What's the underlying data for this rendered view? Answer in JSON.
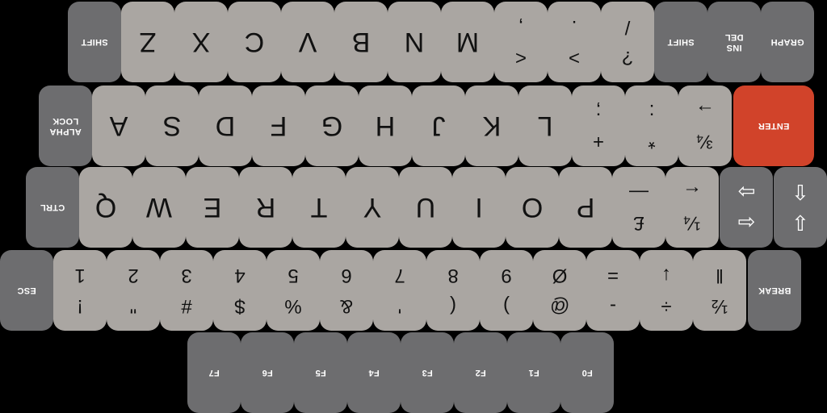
{
  "colors": {
    "light_key": "#aaa6a2",
    "dark_key": "#6d6d6f",
    "enter_key": "#d1432a",
    "background": "#000000"
  },
  "keyboard": {
    "row_function": [
      {
        "id": "f0",
        "label": "F0"
      },
      {
        "id": "f1",
        "label": "F1"
      },
      {
        "id": "f2",
        "label": "F2"
      },
      {
        "id": "f3",
        "label": "F3"
      },
      {
        "id": "f4",
        "label": "F4"
      },
      {
        "id": "f5",
        "label": "F5"
      },
      {
        "id": "f6",
        "label": "F6"
      },
      {
        "id": "f7",
        "label": "F7"
      }
    ],
    "row_number": [
      {
        "id": "esc",
        "label": "ESC"
      },
      {
        "id": "1",
        "top": "!",
        "bottom": "1"
      },
      {
        "id": "2",
        "top": "\"",
        "bottom": "2"
      },
      {
        "id": "3",
        "top": "#",
        "bottom": "3"
      },
      {
        "id": "4",
        "top": "$",
        "bottom": "4"
      },
      {
        "id": "5",
        "top": "%",
        "bottom": "5"
      },
      {
        "id": "6",
        "top": "&",
        "bottom": "6"
      },
      {
        "id": "7",
        "top": "'",
        "bottom": "7"
      },
      {
        "id": "8",
        "top": "(",
        "bottom": "8"
      },
      {
        "id": "9",
        "top": ")",
        "bottom": "9"
      },
      {
        "id": "0",
        "top": "@",
        "bottom": "Ø"
      },
      {
        "id": "minus",
        "top": "-",
        "bottom": "="
      },
      {
        "id": "divide",
        "top": "÷",
        "bottom": "↓"
      },
      {
        "id": "half",
        "top": "½",
        "bottom": "‖"
      },
      {
        "id": "break",
        "label": "BREAK"
      }
    ],
    "row_top": [
      {
        "id": "ctrl",
        "label": "CTRL"
      },
      {
        "id": "q",
        "letter": "Q"
      },
      {
        "id": "w",
        "letter": "W"
      },
      {
        "id": "e",
        "letter": "E"
      },
      {
        "id": "r",
        "letter": "R"
      },
      {
        "id": "t",
        "letter": "T"
      },
      {
        "id": "y",
        "letter": "Y"
      },
      {
        "id": "u",
        "letter": "U"
      },
      {
        "id": "i",
        "letter": "I"
      },
      {
        "id": "o",
        "letter": "O"
      },
      {
        "id": "p",
        "letter": "P"
      },
      {
        "id": "pound",
        "top": "£",
        "bottom": "—"
      },
      {
        "id": "quarter",
        "top": "¼",
        "bottom": "←"
      },
      {
        "id": "arrows-lr",
        "top": "⇦",
        "bottom": "⇨"
      },
      {
        "id": "arrows-ud",
        "top": "⇩",
        "bottom": "⇧"
      }
    ],
    "row_home": [
      {
        "id": "alpha-lock",
        "label": "ALPHA LOCK"
      },
      {
        "id": "a",
        "letter": "A"
      },
      {
        "id": "s",
        "letter": "S"
      },
      {
        "id": "d",
        "letter": "D"
      },
      {
        "id": "f",
        "letter": "F"
      },
      {
        "id": "g",
        "letter": "G"
      },
      {
        "id": "h",
        "letter": "H"
      },
      {
        "id": "j",
        "letter": "J"
      },
      {
        "id": "k",
        "letter": "K"
      },
      {
        "id": "l",
        "letter": "L"
      },
      {
        "id": "semicolon",
        "top": "+",
        "bottom": ";"
      },
      {
        "id": "colon",
        "top": "*",
        "bottom": ":"
      },
      {
        "id": "threequarter",
        "top": "¾",
        "bottom": "→"
      },
      {
        "id": "enter",
        "label": "ENTER"
      }
    ],
    "row_bottom": [
      {
        "id": "shift-left",
        "label": "SHIFT"
      },
      {
        "id": "z",
        "letter": "Z"
      },
      {
        "id": "x",
        "letter": "X"
      },
      {
        "id": "c",
        "letter": "C"
      },
      {
        "id": "v",
        "letter": "V"
      },
      {
        "id": "b",
        "letter": "B"
      },
      {
        "id": "n",
        "letter": "N"
      },
      {
        "id": "m",
        "letter": "M"
      },
      {
        "id": "comma",
        "top": "<",
        "bottom": ","
      },
      {
        "id": "period",
        "top": ">",
        "bottom": "."
      },
      {
        "id": "slash",
        "top": "?",
        "bottom": "/"
      },
      {
        "id": "shift-right",
        "label": "SHIFT"
      },
      {
        "id": "del-ins",
        "label": "INS DEL"
      },
      {
        "id": "graph",
        "label": "GRAPH"
      }
    ]
  }
}
